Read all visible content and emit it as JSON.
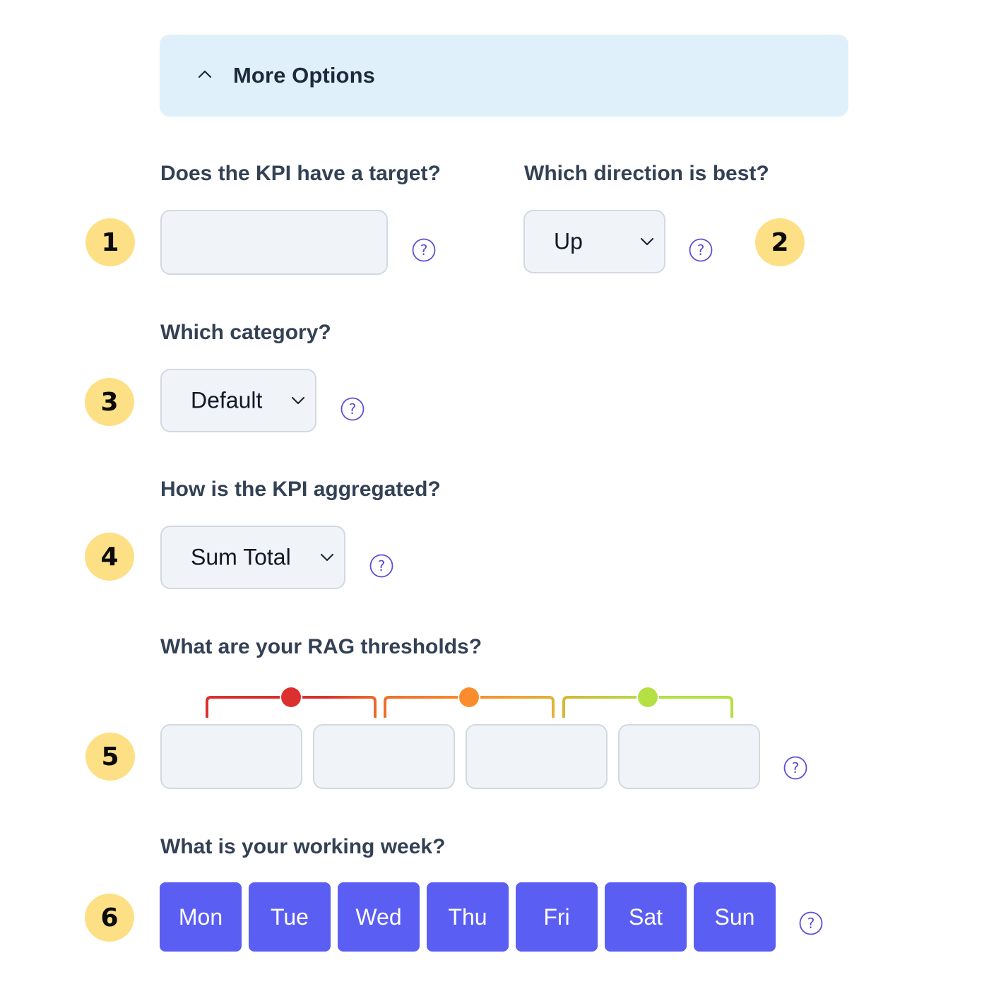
{
  "panel": {
    "title": "More Options",
    "expanded": true,
    "icon": "chevron-up-icon",
    "background": "#e0f0fb"
  },
  "badges": [
    "1",
    "2",
    "3",
    "4",
    "5",
    "6"
  ],
  "target": {
    "label": "Does the KPI have a target?",
    "value": "",
    "placeholder": "",
    "help_icon": "question-circle-icon"
  },
  "direction": {
    "label": "Which direction is best?",
    "value": "Up",
    "help_icon": "question-circle-icon"
  },
  "category": {
    "label": "Which category?",
    "value": "Default",
    "help_icon": "question-circle-icon"
  },
  "aggregation": {
    "label": "How is the KPI aggregated?",
    "value": "Sum Total",
    "help_icon": "question-circle-icon"
  },
  "rag": {
    "label": "What are your RAG thresholds?",
    "inputs": [
      "",
      "",
      "",
      ""
    ],
    "colors": {
      "red": "#dc2f2f",
      "orange": "#fb8c2d",
      "green": "#b5e043"
    },
    "help_icon": "question-circle-icon"
  },
  "working_week": {
    "label": "What is your working week?",
    "days": [
      {
        "label": "Mon",
        "selected": true
      },
      {
        "label": "Tue",
        "selected": true
      },
      {
        "label": "Wed",
        "selected": true
      },
      {
        "label": "Thu",
        "selected": true
      },
      {
        "label": "Fri",
        "selected": true
      },
      {
        "label": "Sat",
        "selected": true
      },
      {
        "label": "Sun",
        "selected": true
      }
    ],
    "help_icon": "question-circle-icon"
  },
  "colors": {
    "accent": "#5b5ef3",
    "badge": "#fde085",
    "help_icon": "#5b4fd8",
    "label_text": "#334155"
  }
}
